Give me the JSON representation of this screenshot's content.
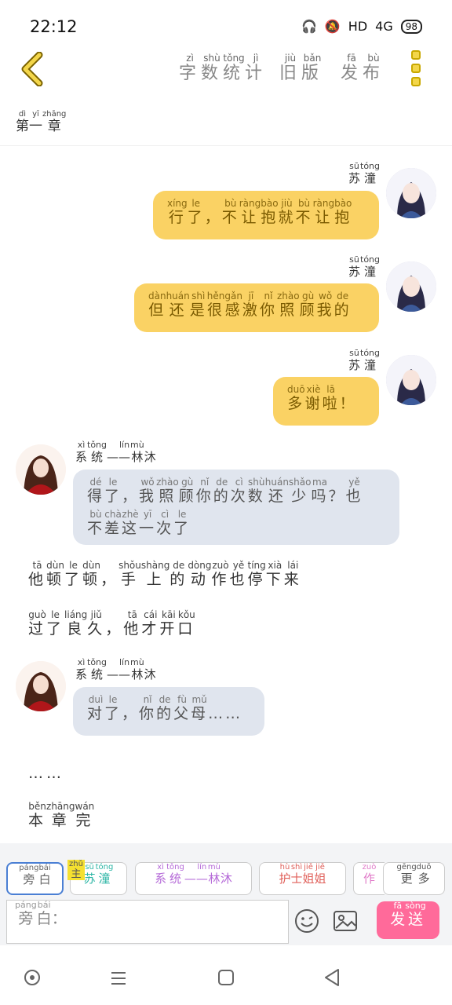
{
  "status": {
    "time": "22:12",
    "network": "HD",
    "signal": "4G",
    "battery": "98"
  },
  "header": {
    "nav": [
      {
        "text": "字数统计",
        "py": [
          "zì",
          "shù",
          "tǒng",
          "jì"
        ]
      },
      {
        "text": "旧版",
        "py": [
          "jiù",
          "bǎn"
        ]
      },
      {
        "text": "发布",
        "py": [
          "fā",
          "bù"
        ]
      }
    ]
  },
  "chapter": {
    "text": "第一章",
    "py": [
      "dì",
      "yī",
      "zhāng"
    ]
  },
  "messages": [
    {
      "speaker": "苏潼",
      "speaker_py": [
        "sū",
        "tóng"
      ],
      "lines": [
        {
          "text": "行了，不让抱就不让抱",
          "py": [
            "xíng",
            "le",
            "",
            "bù",
            "ràng",
            "bào",
            "jiù",
            "bù",
            "ràng",
            "bào"
          ]
        }
      ]
    },
    {
      "speaker": "苏潼",
      "speaker_py": [
        "sū",
        "tóng"
      ],
      "lines": [
        {
          "text": "但还是很感激你照顾我的",
          "py": [
            "dàn",
            "huán",
            "shì",
            "hěn",
            "gǎn",
            "jī",
            "nǐ",
            "zhào",
            "gù",
            "wǒ",
            "de"
          ]
        }
      ]
    },
    {
      "speaker": "苏潼",
      "speaker_py": [
        "sū",
        "tóng"
      ],
      "lines": [
        {
          "text": "多谢啦！",
          "py": [
            "duō",
            "xiè",
            "lā",
            ""
          ]
        }
      ]
    },
    {
      "speaker": "系统——林沐",
      "speaker_py": [
        "xì",
        "tǒng",
        "",
        "lín",
        "mù"
      ],
      "lines": [
        {
          "text": "得了，我照顾你的次数还少吗？也",
          "py": [
            "dé",
            "le",
            "",
            "wǒ",
            "zhào",
            "gù",
            "nǐ",
            "de",
            "cì",
            "shù",
            "huán",
            "shǎo",
            "ma",
            "",
            "yě"
          ]
        },
        {
          "text": "不差这一次了",
          "py": [
            "bù",
            "chà",
            "zhè",
            "yī",
            "cì",
            "le"
          ]
        }
      ]
    },
    {
      "narration": "他顿了顿，手上的动作也停下来",
      "py": [
        "tā",
        "dùn",
        "le",
        "dùn",
        "",
        "shǒu",
        "shàng",
        "de",
        "dòng",
        "zuò",
        "yě",
        "tíng",
        "xià",
        "lái"
      ]
    },
    {
      "narration": "过了良久，他才开口",
      "py": [
        "guò",
        "le",
        "liáng",
        "jiǔ",
        "",
        "tā",
        "cái",
        "kāi",
        "kǒu"
      ]
    },
    {
      "speaker": "系统——林沐",
      "speaker_py": [
        "xì",
        "tǒng",
        "",
        "lín",
        "mù"
      ],
      "lines": [
        {
          "text": "对了，你的父母……",
          "py": [
            "duì",
            "le",
            "",
            "nǐ",
            "de",
            "fù",
            "mǔ",
            "",
            ""
          ]
        }
      ]
    },
    {
      "narration": "……",
      "py": [
        "",
        ""
      ]
    },
    {
      "narration": "本章完",
      "py": [
        "běn",
        "zhāng",
        "wán"
      ]
    }
  ],
  "roles": [
    {
      "text": "旁白",
      "py": [
        "páng",
        "bái"
      ],
      "color": "#666666"
    },
    {
      "text": "苏潼",
      "py": [
        "sū",
        "tóng"
      ],
      "color": "#2bb5a5",
      "badge": "主",
      "badge_py": "zhǔ"
    },
    {
      "text": "系统——林沐",
      "py": [
        "xì",
        "tǒng",
        "",
        "lín",
        "mù"
      ],
      "color": "#b56ad8"
    },
    {
      "text": "护士姐姐",
      "py": [
        "hù",
        "shì",
        "jiě",
        "jiě"
      ],
      "color": "#e0605a"
    },
    {
      "text": "作",
      "py": [
        "zuò"
      ],
      "color": "#e07ac8"
    },
    {
      "text": "更多",
      "py": [
        "gēng",
        "duō"
      ],
      "color": "#555555"
    }
  ],
  "input": {
    "placeholder": "旁白：",
    "placeholder_py": [
      "páng",
      "bái",
      ""
    ]
  },
  "send": {
    "text": "发送",
    "py": [
      "fā",
      "sòng"
    ]
  },
  "icons": {
    "back": "chevron-left-icon",
    "menu": "kebab-icon",
    "emoji": "smile-icon",
    "image": "image-icon"
  }
}
